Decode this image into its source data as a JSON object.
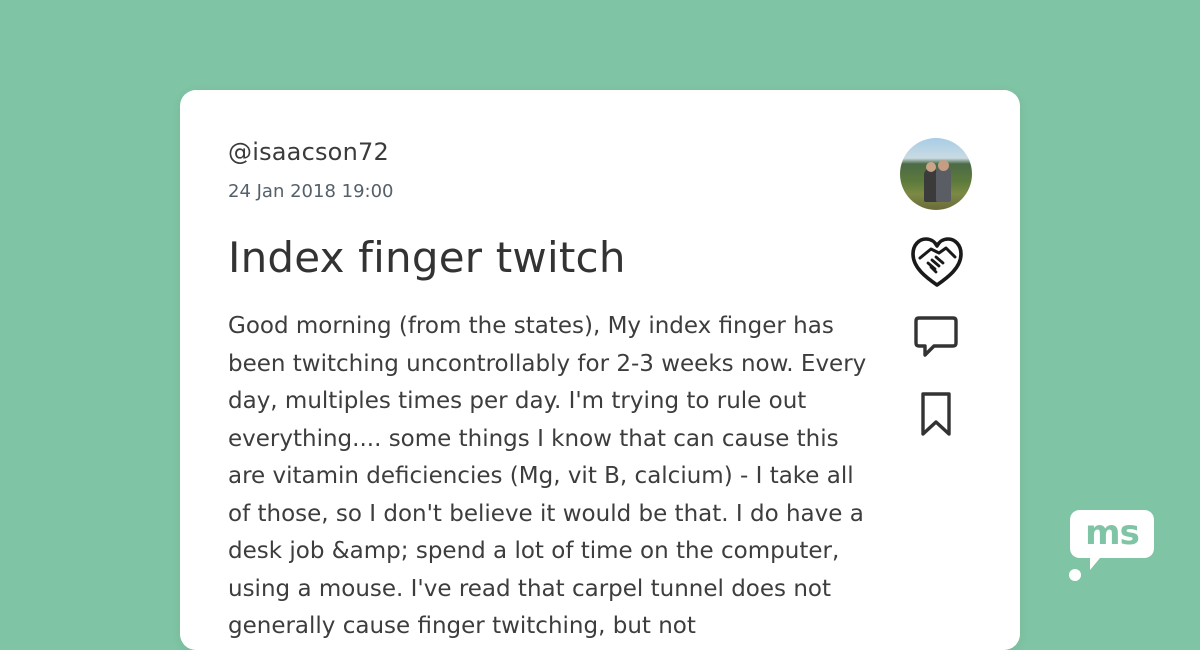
{
  "post": {
    "username": "@isaacson72",
    "timestamp": "24 Jan 2018 19:00",
    "title": "Index finger twitch",
    "body": "Good morning (from the states), My index finger has been twitching uncontrollably for 2-3 weeks now. Every day, multiples times per day. I'm trying to rule out everything.... some things I know that can cause this are vitamin deficiencies (Mg, vit B, calcium) - I take all of those, so I don't believe it would be that. I do have a desk job &amp; spend a lot of time on the computer, using a mouse. I've read that carpel tunnel does not generally cause finger twitching, but not"
  },
  "actions": {
    "avatar": "avatar-photo",
    "hug": "hug-icon",
    "comment": "comment-icon",
    "bookmark": "bookmark-icon"
  },
  "brand": {
    "logo_text": "ms"
  },
  "colors": {
    "background": "#7fc4a4",
    "card": "#ffffff",
    "text": "#333333",
    "logo": "#ffffff"
  }
}
